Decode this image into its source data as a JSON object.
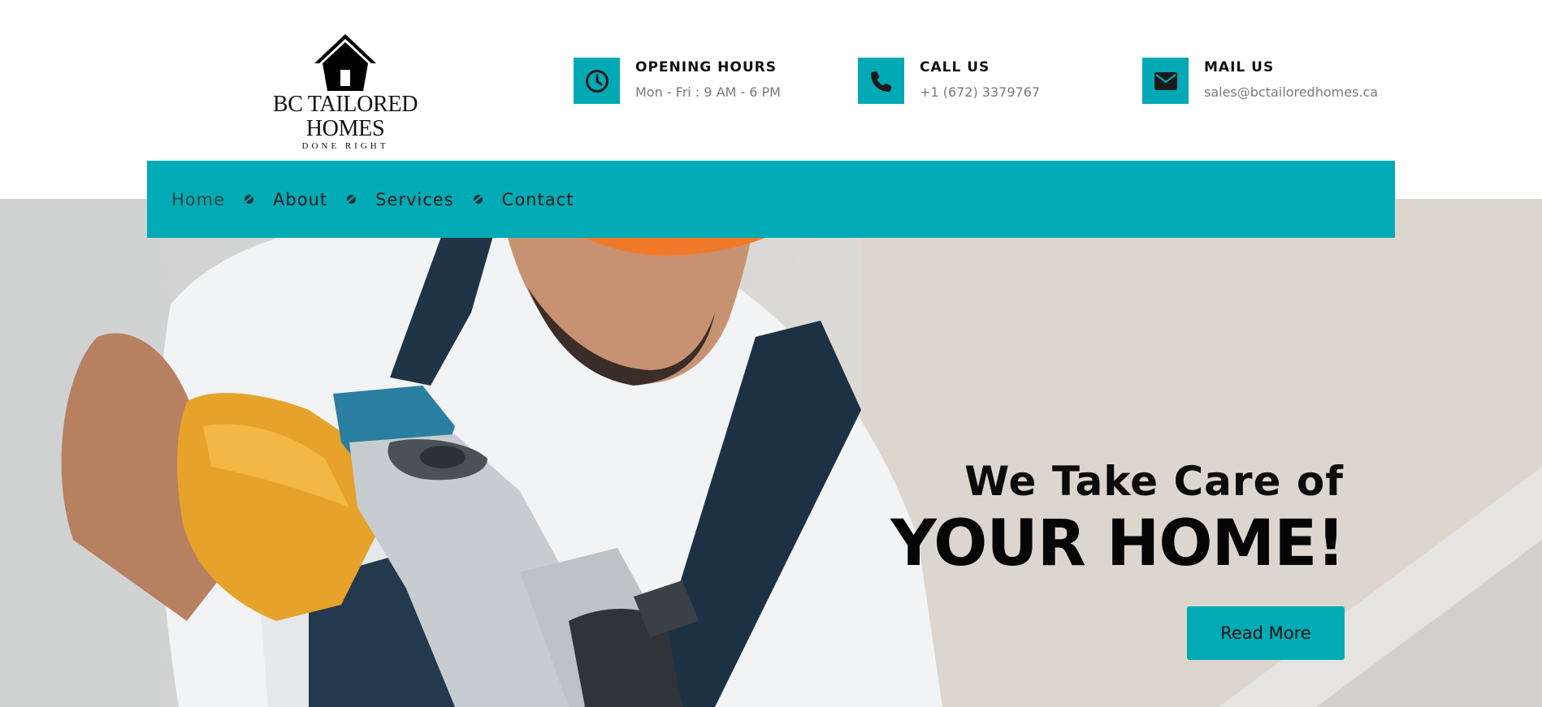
{
  "brand": {
    "name": "BC TAILORED HOMES",
    "tagline": "DONE RIGHT",
    "logo_icon": "house-icon"
  },
  "info": {
    "hours": {
      "icon": "clock-icon",
      "title": "OPENING HOURS",
      "value": "Mon - Fri : 9 AM - 6 PM"
    },
    "call": {
      "icon": "phone-icon",
      "title": "CALL US",
      "value": "+1 (672) 3379767"
    },
    "mail": {
      "icon": "envelope-icon",
      "title": "MAIL US",
      "value": "sales@bctailoredhomes.ca"
    }
  },
  "nav": {
    "items": [
      {
        "label": "Home"
      },
      {
        "label": "About"
      },
      {
        "label": "Services"
      },
      {
        "label": "Contact"
      }
    ]
  },
  "hero": {
    "subtitle": "We Take Care of",
    "title": "YOUR HOME!",
    "cta_label": "Read More"
  },
  "colors": {
    "accent": "#00abb5",
    "text_dark": "#111111",
    "text_muted": "#7a7a7a"
  }
}
